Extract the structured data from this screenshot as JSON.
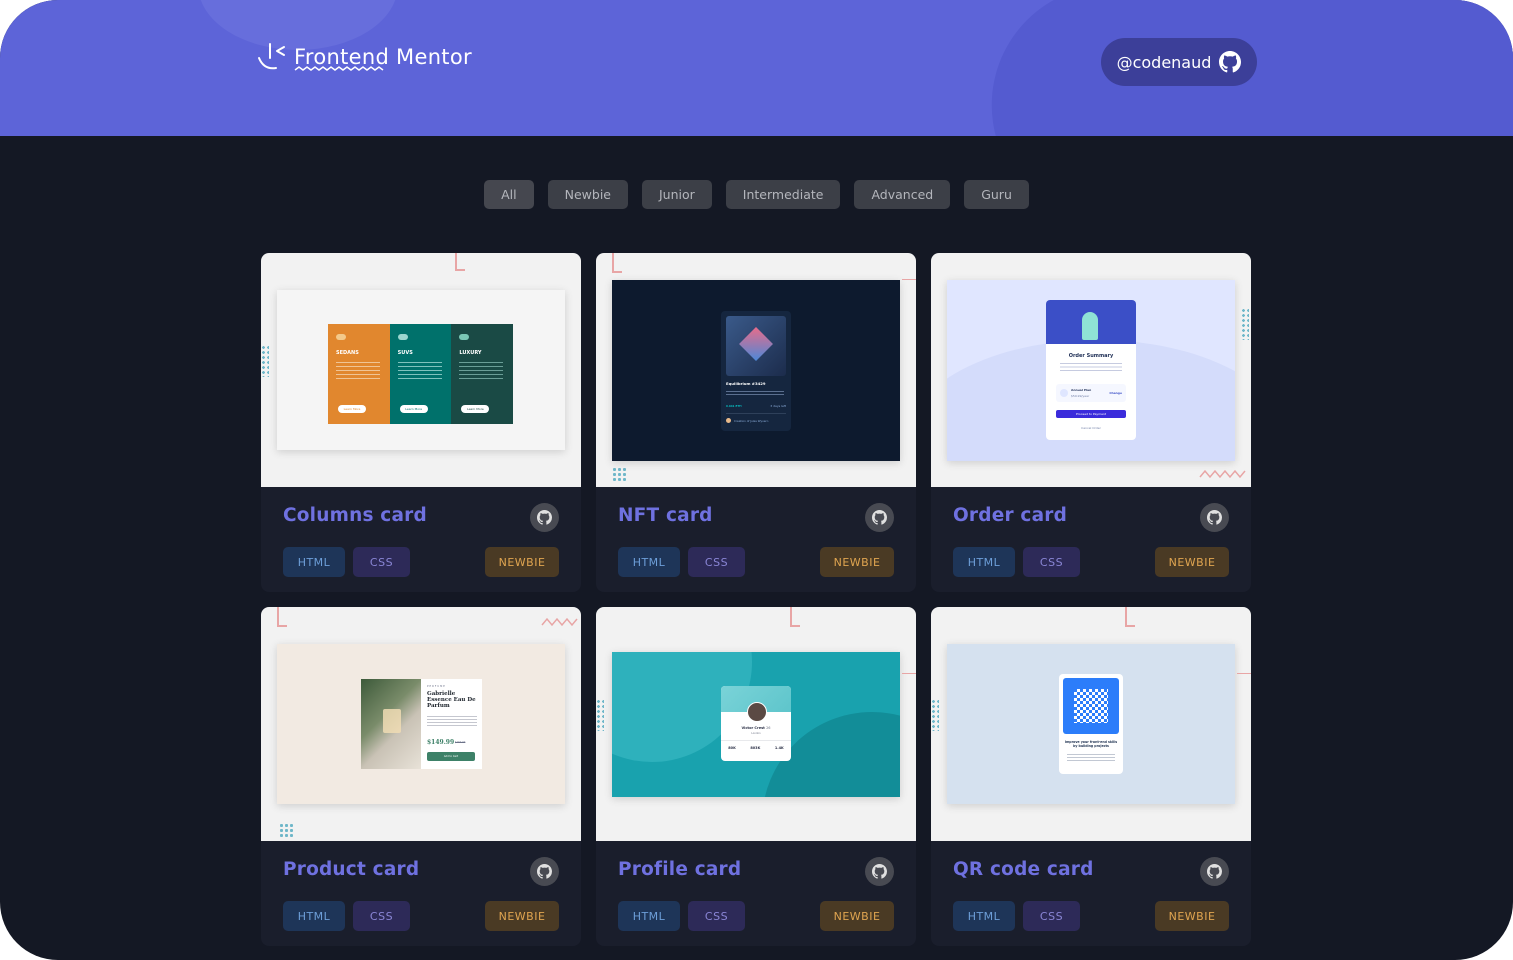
{
  "header": {
    "logo_text": "Frontend Mentor",
    "user_handle": "@codenaud"
  },
  "filters": [
    "All",
    "Newbie",
    "Junior",
    "Intermediate",
    "Advanced",
    "Guru"
  ],
  "cards": [
    {
      "title": "Columns card",
      "tags": [
        "HTML",
        "CSS"
      ],
      "level": "NEWBIE"
    },
    {
      "title": "NFT card",
      "tags": [
        "HTML",
        "CSS"
      ],
      "level": "NEWBIE"
    },
    {
      "title": "Order card",
      "tags": [
        "HTML",
        "CSS"
      ],
      "level": "NEWBIE"
    },
    {
      "title": "Product card",
      "tags": [
        "HTML",
        "CSS"
      ],
      "level": "NEWBIE"
    },
    {
      "title": "Profile card",
      "tags": [
        "HTML",
        "CSS"
      ],
      "level": "NEWBIE"
    },
    {
      "title": "QR code card",
      "tags": [
        "HTML",
        "CSS"
      ],
      "level": "NEWBIE"
    }
  ],
  "thumbnails": {
    "columns": {
      "cols": [
        "SEDANS",
        "SUVS",
        "LUXURY"
      ],
      "button": "Learn More"
    },
    "nft": {
      "title": "Equilibrium #3429",
      "price": "0.041 ETH",
      "time": "3 days left",
      "creator": "Creation of Jules Wyvern"
    },
    "order": {
      "title": "Order Summary",
      "plan": "Annual Plan",
      "price": "$59.99/year",
      "change": "Change",
      "pay": "Proceed to Payment",
      "cancel": "Cancel Order"
    },
    "product": {
      "category": "PERFUME",
      "name": "Gabrielle Essence Eau De Parfum",
      "price": "$149.99",
      "old_price": "$169.99",
      "cta": "Add to Cart"
    },
    "profile": {
      "name": "Victor Crest",
      "age": "26",
      "city": "London",
      "stats": [
        "80K",
        "803K",
        "1.4K"
      ]
    },
    "qr": {
      "heading": "Improve your front-end skills by building projects"
    }
  },
  "colors": {
    "header": "#5d64d8",
    "page": "#141824",
    "card": "#1a1e2c",
    "title": "#6f71e0",
    "html_tag": "#6d9ed8",
    "css_tag": "#8a86d6",
    "level_tag": "#e0a550"
  },
  "icons": {
    "logo": "frontend-mentor-logo",
    "github": "github-icon"
  }
}
